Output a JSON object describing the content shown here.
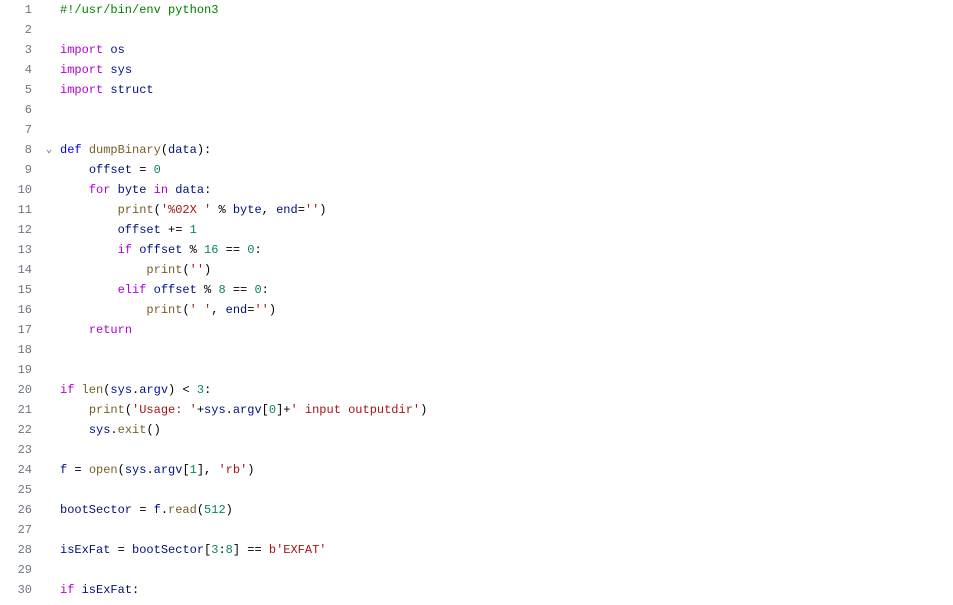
{
  "editor": {
    "lines": [
      {
        "num": "1",
        "fold": "",
        "tokens": [
          [
            "comment",
            "#!/usr/bin/env python3"
          ]
        ]
      },
      {
        "num": "2",
        "fold": "",
        "tokens": []
      },
      {
        "num": "3",
        "fold": "",
        "tokens": [
          [
            "kw-import",
            "import"
          ],
          [
            "op",
            " "
          ],
          [
            "ident",
            "os"
          ]
        ]
      },
      {
        "num": "4",
        "fold": "",
        "tokens": [
          [
            "kw-import",
            "import"
          ],
          [
            "op",
            " "
          ],
          [
            "ident",
            "sys"
          ]
        ]
      },
      {
        "num": "5",
        "fold": "",
        "tokens": [
          [
            "kw-import",
            "import"
          ],
          [
            "op",
            " "
          ],
          [
            "ident",
            "struct"
          ]
        ]
      },
      {
        "num": "6",
        "fold": "",
        "tokens": []
      },
      {
        "num": "7",
        "fold": "",
        "tokens": []
      },
      {
        "num": "8",
        "fold": "v",
        "tokens": [
          [
            "kw-def",
            "def"
          ],
          [
            "op",
            " "
          ],
          [
            "fn-def",
            "dumpBinary"
          ],
          [
            "punct",
            "("
          ],
          [
            "ident",
            "data"
          ],
          [
            "punct",
            "):"
          ]
        ]
      },
      {
        "num": "9",
        "fold": "",
        "tokens": [
          [
            "op",
            "    "
          ],
          [
            "ident",
            "offset"
          ],
          [
            "op",
            " = "
          ],
          [
            "num",
            "0"
          ]
        ]
      },
      {
        "num": "10",
        "fold": "",
        "tokens": [
          [
            "op",
            "    "
          ],
          [
            "kw-ctrl",
            "for"
          ],
          [
            "op",
            " "
          ],
          [
            "ident",
            "byte"
          ],
          [
            "op",
            " "
          ],
          [
            "kw-ctrl",
            "in"
          ],
          [
            "op",
            " "
          ],
          [
            "ident",
            "data"
          ],
          [
            "punct",
            ":"
          ]
        ]
      },
      {
        "num": "11",
        "fold": "",
        "tokens": [
          [
            "op",
            "        "
          ],
          [
            "fn",
            "print"
          ],
          [
            "punct",
            "("
          ],
          [
            "str",
            "'%02X '"
          ],
          [
            "op",
            " % "
          ],
          [
            "ident",
            "byte"
          ],
          [
            "punct",
            ", "
          ],
          [
            "ident",
            "end"
          ],
          [
            "op",
            "="
          ],
          [
            "str",
            "''"
          ],
          [
            "punct",
            ")"
          ]
        ]
      },
      {
        "num": "12",
        "fold": "",
        "tokens": [
          [
            "op",
            "        "
          ],
          [
            "ident",
            "offset"
          ],
          [
            "op",
            " += "
          ],
          [
            "num",
            "1"
          ]
        ]
      },
      {
        "num": "13",
        "fold": "",
        "tokens": [
          [
            "op",
            "        "
          ],
          [
            "kw-ctrl",
            "if"
          ],
          [
            "op",
            " "
          ],
          [
            "ident",
            "offset"
          ],
          [
            "op",
            " % "
          ],
          [
            "num",
            "16"
          ],
          [
            "op",
            " == "
          ],
          [
            "num",
            "0"
          ],
          [
            "punct",
            ":"
          ]
        ]
      },
      {
        "num": "14",
        "fold": "",
        "tokens": [
          [
            "op",
            "            "
          ],
          [
            "fn",
            "print"
          ],
          [
            "punct",
            "("
          ],
          [
            "str",
            "''"
          ],
          [
            "punct",
            ")"
          ]
        ]
      },
      {
        "num": "15",
        "fold": "",
        "tokens": [
          [
            "op",
            "        "
          ],
          [
            "kw-ctrl",
            "elif"
          ],
          [
            "op",
            " "
          ],
          [
            "ident",
            "offset"
          ],
          [
            "op",
            " % "
          ],
          [
            "num",
            "8"
          ],
          [
            "op",
            " == "
          ],
          [
            "num",
            "0"
          ],
          [
            "punct",
            ":"
          ]
        ]
      },
      {
        "num": "16",
        "fold": "",
        "tokens": [
          [
            "op",
            "            "
          ],
          [
            "fn",
            "print"
          ],
          [
            "punct",
            "("
          ],
          [
            "str",
            "' '"
          ],
          [
            "punct",
            ", "
          ],
          [
            "ident",
            "end"
          ],
          [
            "op",
            "="
          ],
          [
            "str",
            "''"
          ],
          [
            "punct",
            ")"
          ]
        ]
      },
      {
        "num": "17",
        "fold": "",
        "tokens": [
          [
            "op",
            "    "
          ],
          [
            "kw-ctrl",
            "return"
          ]
        ]
      },
      {
        "num": "18",
        "fold": "",
        "tokens": []
      },
      {
        "num": "19",
        "fold": "",
        "tokens": []
      },
      {
        "num": "20",
        "fold": "",
        "tokens": [
          [
            "kw-ctrl",
            "if"
          ],
          [
            "op",
            " "
          ],
          [
            "fn",
            "len"
          ],
          [
            "punct",
            "("
          ],
          [
            "ident",
            "sys"
          ],
          [
            "punct",
            "."
          ],
          [
            "ident",
            "argv"
          ],
          [
            "punct",
            ") < "
          ],
          [
            "num",
            "3"
          ],
          [
            "punct",
            ":"
          ]
        ]
      },
      {
        "num": "21",
        "fold": "",
        "tokens": [
          [
            "op",
            "    "
          ],
          [
            "fn",
            "print"
          ],
          [
            "punct",
            "("
          ],
          [
            "str",
            "'Usage: '"
          ],
          [
            "op",
            "+"
          ],
          [
            "ident",
            "sys"
          ],
          [
            "punct",
            "."
          ],
          [
            "ident",
            "argv"
          ],
          [
            "punct",
            "["
          ],
          [
            "num",
            "0"
          ],
          [
            "punct",
            "]"
          ],
          [
            "op",
            "+"
          ],
          [
            "str",
            "' input outputdir'"
          ],
          [
            "punct",
            ")"
          ]
        ]
      },
      {
        "num": "22",
        "fold": "",
        "tokens": [
          [
            "op",
            "    "
          ],
          [
            "ident",
            "sys"
          ],
          [
            "punct",
            "."
          ],
          [
            "fn",
            "exit"
          ],
          [
            "punct",
            "()"
          ]
        ]
      },
      {
        "num": "23",
        "fold": "",
        "tokens": []
      },
      {
        "num": "24",
        "fold": "",
        "tokens": [
          [
            "ident",
            "f"
          ],
          [
            "op",
            " = "
          ],
          [
            "fn",
            "open"
          ],
          [
            "punct",
            "("
          ],
          [
            "ident",
            "sys"
          ],
          [
            "punct",
            "."
          ],
          [
            "ident",
            "argv"
          ],
          [
            "punct",
            "["
          ],
          [
            "num",
            "1"
          ],
          [
            "punct",
            "], "
          ],
          [
            "str",
            "'rb'"
          ],
          [
            "punct",
            ")"
          ]
        ]
      },
      {
        "num": "25",
        "fold": "",
        "tokens": []
      },
      {
        "num": "26",
        "fold": "",
        "tokens": [
          [
            "ident",
            "bootSector"
          ],
          [
            "op",
            " = "
          ],
          [
            "ident",
            "f"
          ],
          [
            "punct",
            "."
          ],
          [
            "fn",
            "read"
          ],
          [
            "punct",
            "("
          ],
          [
            "num",
            "512"
          ],
          [
            "punct",
            ")"
          ]
        ]
      },
      {
        "num": "27",
        "fold": "",
        "tokens": []
      },
      {
        "num": "28",
        "fold": "",
        "tokens": [
          [
            "ident",
            "isExFat"
          ],
          [
            "op",
            " = "
          ],
          [
            "ident",
            "bootSector"
          ],
          [
            "punct",
            "["
          ],
          [
            "num",
            "3"
          ],
          [
            "punct",
            ":"
          ],
          [
            "num",
            "8"
          ],
          [
            "punct",
            "] == "
          ],
          [
            "str",
            "b'EXFAT'"
          ]
        ]
      },
      {
        "num": "29",
        "fold": "",
        "tokens": []
      },
      {
        "num": "30",
        "fold": "",
        "tokens": [
          [
            "kw-ctrl",
            "if"
          ],
          [
            "op",
            " "
          ],
          [
            "ident",
            "isExFat"
          ],
          [
            "punct",
            ":"
          ]
        ]
      }
    ],
    "fold_icon_open": "⌄"
  }
}
